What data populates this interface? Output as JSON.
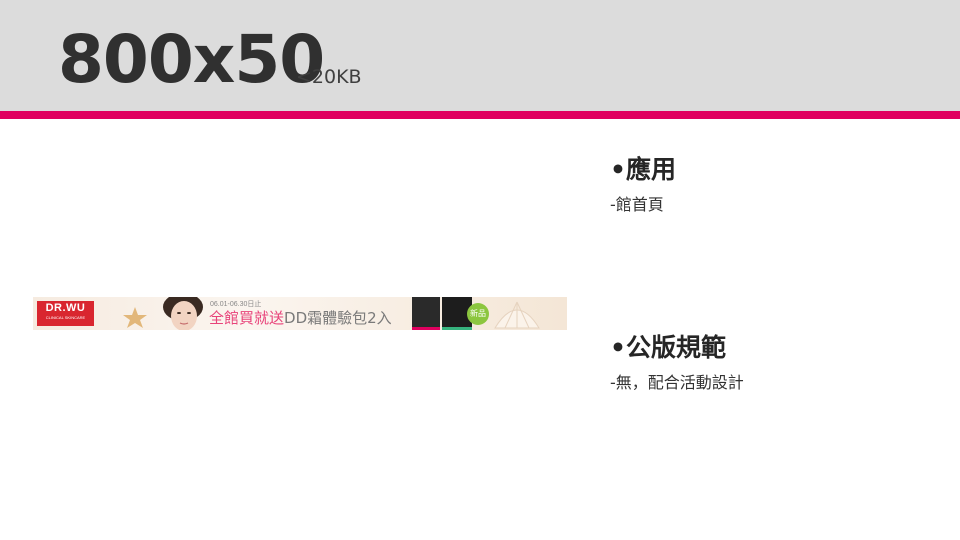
{
  "header": {
    "title": "800x50",
    "subtitle": "<20KB",
    "accent_color": "#e0005f",
    "background_color": "#dcdcdc"
  },
  "banner": {
    "logo_text": "DR.WU",
    "logo_subtext": "CLINICAL SKINCARE",
    "date_text": "06.01-06.30日止",
    "promo_highlight": "全館買就送",
    "promo_rest": "DD霜體驗包2入",
    "badge_text": "新品",
    "icons": [
      "starfish-shell-icon",
      "woman-face-image",
      "product-box-icon",
      "seashell-icon"
    ]
  },
  "sections": [
    {
      "heading": "•應用",
      "items": [
        "-館首頁"
      ]
    },
    {
      "heading": "•公版規範",
      "items": [
        "-無，配合活動設計"
      ]
    }
  ]
}
